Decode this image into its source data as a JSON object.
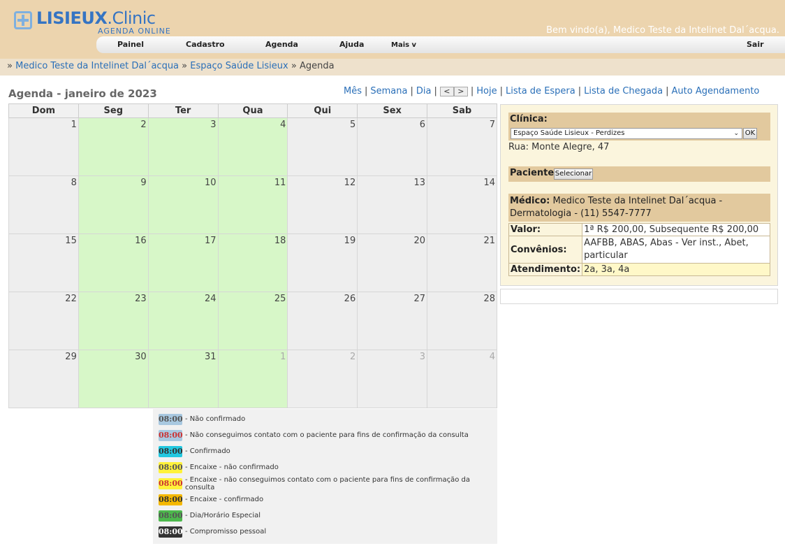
{
  "header": {
    "brand_main": "LISIEUX",
    "brand_ext": ".Clinic",
    "brand_tag": "AGENDA ONLINE",
    "welcome": "Bem vindo(a), Medico Teste da Intelinet Dal´acqua."
  },
  "menu": {
    "items": [
      "Painel",
      "Cadastro",
      "Agenda",
      "Ajuda",
      "Mais v"
    ],
    "logout": "Sair"
  },
  "breadcrumb": {
    "prefix": "»",
    "link1": "Medico Teste da Intelinet Dal´acqua",
    "sep": "»",
    "link2": "Espaço Saúde Lisieux",
    "current": "» Agenda"
  },
  "agenda": {
    "title": "Agenda - janeiro de 2023",
    "nav": {
      "month": "Mês",
      "week": "Semana",
      "day": "Dia",
      "prev": "<",
      "next": ">",
      "today": "Hoje",
      "waiting_list": "Lista de Espera",
      "arrival_list": "Lista de Chegada",
      "auto_scheduling": "Auto Agendamento"
    },
    "weekdays": [
      "Dom",
      "Seg",
      "Ter",
      "Qua",
      "Qui",
      "Sex",
      "Sab"
    ],
    "weeks": [
      [
        {
          "d": "1",
          "t": "off"
        },
        {
          "d": "2",
          "t": "work"
        },
        {
          "d": "3",
          "t": "work"
        },
        {
          "d": "4",
          "t": "work"
        },
        {
          "d": "5",
          "t": "off"
        },
        {
          "d": "6",
          "t": "off"
        },
        {
          "d": "7",
          "t": "off"
        }
      ],
      [
        {
          "d": "8",
          "t": "off"
        },
        {
          "d": "9",
          "t": "work"
        },
        {
          "d": "10",
          "t": "work"
        },
        {
          "d": "11",
          "t": "work"
        },
        {
          "d": "12",
          "t": "off"
        },
        {
          "d": "13",
          "t": "off"
        },
        {
          "d": "14",
          "t": "off"
        }
      ],
      [
        {
          "d": "15",
          "t": "off"
        },
        {
          "d": "16",
          "t": "work"
        },
        {
          "d": "17",
          "t": "work"
        },
        {
          "d": "18",
          "t": "work"
        },
        {
          "d": "19",
          "t": "off"
        },
        {
          "d": "20",
          "t": "off"
        },
        {
          "d": "21",
          "t": "off"
        }
      ],
      [
        {
          "d": "22",
          "t": "off"
        },
        {
          "d": "23",
          "t": "work"
        },
        {
          "d": "24",
          "t": "work"
        },
        {
          "d": "25",
          "t": "work"
        },
        {
          "d": "26",
          "t": "off"
        },
        {
          "d": "27",
          "t": "off"
        },
        {
          "d": "28",
          "t": "off"
        }
      ],
      [
        {
          "d": "29",
          "t": "off"
        },
        {
          "d": "30",
          "t": "work"
        },
        {
          "d": "31",
          "t": "work"
        },
        {
          "d": "1",
          "t": "work-other"
        },
        {
          "d": "2",
          "t": "other"
        },
        {
          "d": "3",
          "t": "other"
        },
        {
          "d": "4",
          "t": "other"
        }
      ]
    ]
  },
  "legend": [
    {
      "time": "08:00",
      "bg": "#a8c8e0",
      "fg": "#555555",
      "label": "- Não confirmado"
    },
    {
      "time": "08:00",
      "bg": "#a8c8e0",
      "fg": "#cc3333",
      "label": "- Não conseguimos contato com o paciente para fins de confirmação da consulta"
    },
    {
      "time": "08:00",
      "bg": "#22c8e0",
      "fg": "#333333",
      "label": "- Confirmado"
    },
    {
      "time": "08:00",
      "bg": "#fff23a",
      "fg": "#555555",
      "label": "- Encaixe - não confirmado"
    },
    {
      "time": "08:00",
      "bg": "#fff23a",
      "fg": "#cc3333",
      "label": "- Encaixe - não conseguimos contato com o paciente para fins de confirmação da consulta"
    },
    {
      "time": "08:00",
      "bg": "#f5b800",
      "fg": "#333333",
      "label": "- Encaixe - confirmado"
    },
    {
      "time": "08:00",
      "bg": "#4cb84c",
      "fg": "#555555",
      "label": "- Dia/Horário Especial"
    },
    {
      "time": "08:00",
      "bg": "#333333",
      "fg": "#ffffff",
      "label": "- Compromisso pessoal"
    }
  ],
  "panel": {
    "clinic_label": "Clínica:",
    "clinic_selected": "Espaço Saúde Lisieux - Perdizes",
    "ok_label": "OK",
    "address": "Rua: Monte Alegre, 47",
    "patient_label": "Paciente:",
    "select_label": "Selecionar",
    "doctor_label": "Médico:",
    "doctor_value": "Medico Teste da Intelinet Dal´acqua - Dermatologia - (11) 5547-7777",
    "rows": [
      {
        "key": "Valor:",
        "value": "1ª R$ 200,00, Subsequente R$ 200,00"
      },
      {
        "key": "Convênios:",
        "value": "AAFBB, ABAS, Abas - Ver inst., Abet, particular"
      },
      {
        "key": "Atendimento:",
        "value": "2a, 3a, 4a"
      }
    ]
  }
}
